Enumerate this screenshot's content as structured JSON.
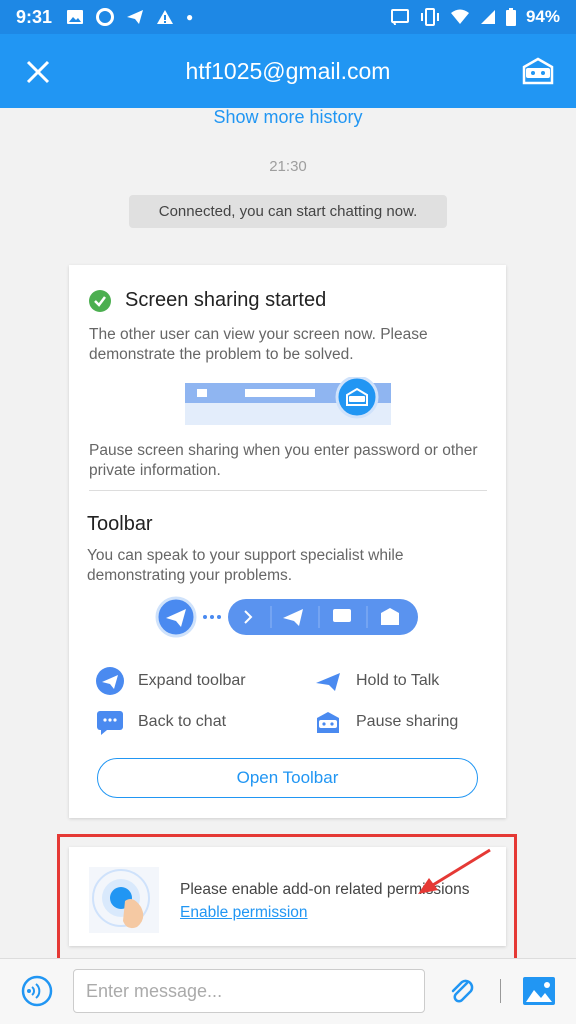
{
  "status_bar": {
    "time": "9:31",
    "battery": "94%",
    "icons_left": [
      "image-icon",
      "lifebuoy-icon",
      "send-icon",
      "warning-icon",
      "dot-icon"
    ],
    "icons_right": [
      "cast-icon",
      "vibrate-icon",
      "wifi-icon",
      "signal-icon",
      "battery-icon"
    ]
  },
  "header": {
    "title": "htf1025@gmail.com",
    "close_icon": "close-icon",
    "right_icon": "agent-icon"
  },
  "chat": {
    "show_more": "Show more history",
    "timestamp": "21:30",
    "system_message": "Connected, you can start chatting now."
  },
  "screen_card": {
    "title": "Screen sharing started",
    "description": "The other user can view your screen now. Please demonstrate the problem to be solved.",
    "privacy_note": "Pause screen sharing when you enter password or other private information.",
    "toolbar_title": "Toolbar",
    "toolbar_description": "You can speak to your support specialist while demonstrating your problems.",
    "legend": [
      {
        "label": "Expand toolbar",
        "icon": "paper-plane-icon"
      },
      {
        "label": "Hold to Talk",
        "icon": "hold-to-talk-icon"
      },
      {
        "label": "Back to chat",
        "icon": "chat-bubble-icon"
      },
      {
        "label": "Pause sharing",
        "icon": "agent-icon"
      }
    ],
    "open_toolbar_label": "Open Toolbar"
  },
  "permission_card": {
    "text": "Please enable add-on related permissions",
    "link": "Enable permission"
  },
  "input_bar": {
    "placeholder": "Enter message..."
  },
  "colors": {
    "primary": "#2196f3",
    "status_bar": "#1e88e5",
    "success": "#4caf50",
    "highlight": "#e53935"
  }
}
